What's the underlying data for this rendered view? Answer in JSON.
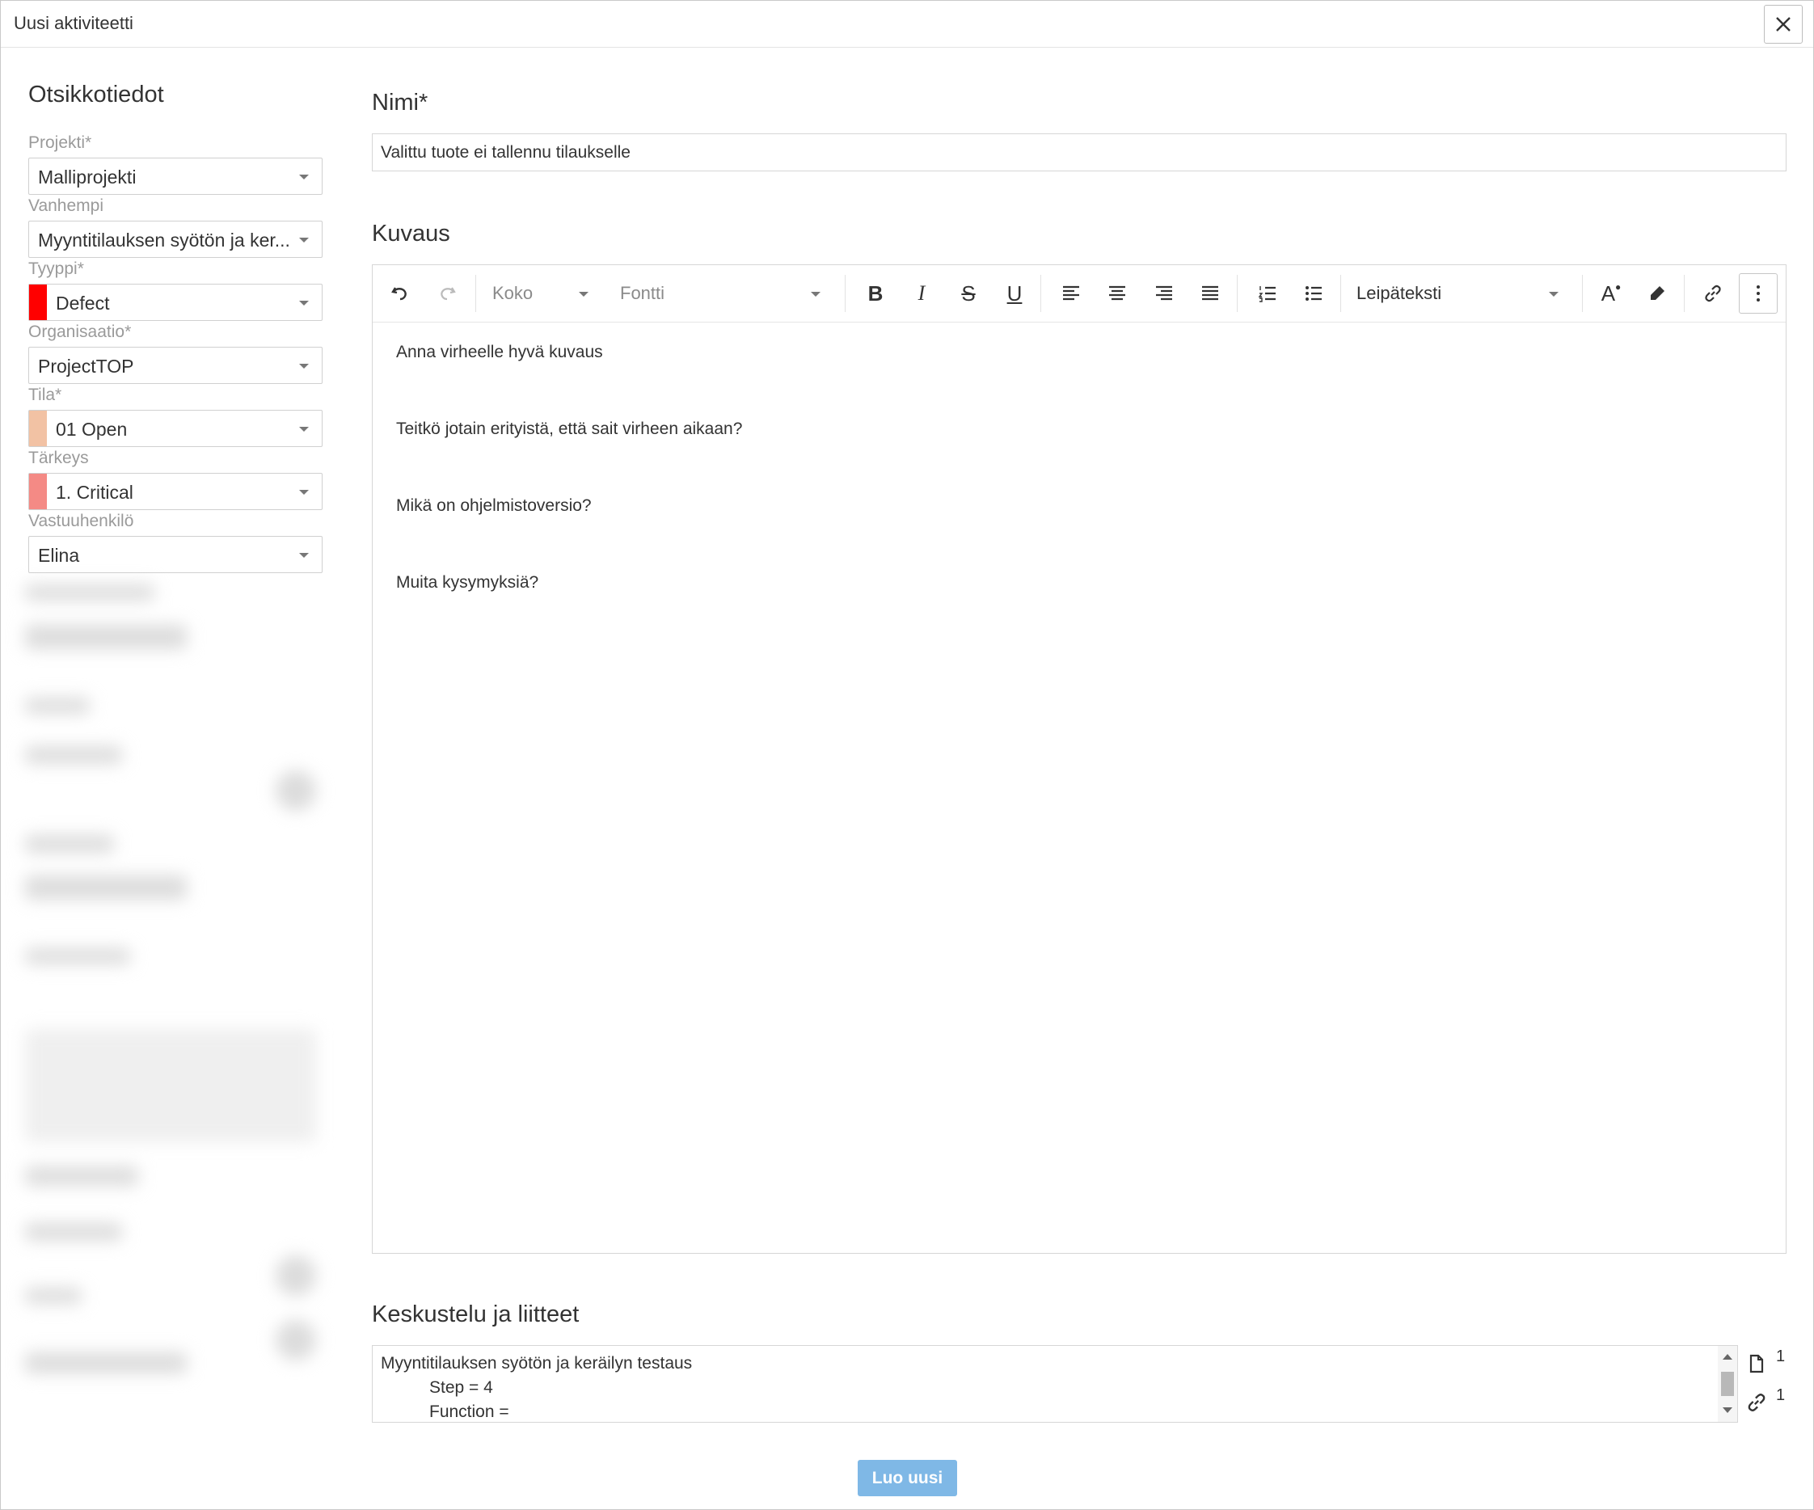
{
  "dialog": {
    "title": "Uusi aktiviteetti"
  },
  "left": {
    "heading": "Otsikkotiedot",
    "fields": {
      "project": {
        "label": "Projekti*",
        "value": "Malliprojekti"
      },
      "parent": {
        "label": "Vanhempi",
        "value": "Myyntitilauksen syötön ja ker..."
      },
      "type": {
        "label": "Tyyppi*",
        "value": "Defect",
        "color": "#ff0000"
      },
      "organisation": {
        "label": "Organisaatio*",
        "value": "ProjectTOP"
      },
      "status": {
        "label": "Tila*",
        "value": "01 Open",
        "color": "#f2c2a4"
      },
      "priority": {
        "label": "Tärkeys",
        "value": "1. Critical",
        "color": "#f48a85"
      },
      "responsible": {
        "label": "Vastuuhenkilö",
        "value": "Elina"
      }
    }
  },
  "name": {
    "heading": "Nimi*",
    "value": "Valittu tuote ei tallennu tilaukselle"
  },
  "description": {
    "heading": "Kuvaus",
    "toolbar": {
      "size_label": "Koko",
      "font_label": "Fontti",
      "style_label": "Leipäteksti",
      "bold": "B",
      "italic": "I",
      "strike": "S",
      "underline": "U",
      "text_color": "A"
    },
    "body": [
      "Anna virheelle hyvä kuvaus",
      "Teitkö jotain erityistä, että sait virheen aikaan?",
      "Mikä on ohjelmistoversio?",
      "Muita kysymyksiä?"
    ]
  },
  "discussion": {
    "heading": "Keskustelu ja liitteet",
    "lines": [
      "Myyntitilauksen syötön ja keräilyn testaus",
      "Step = 4",
      "Function ="
    ],
    "attachment_count": "1",
    "link_count": "1"
  },
  "actions": {
    "create_label": "Luo uusi"
  },
  "colors": {
    "create_button": "#7fb8e6",
    "border": "#d6d6d6"
  }
}
